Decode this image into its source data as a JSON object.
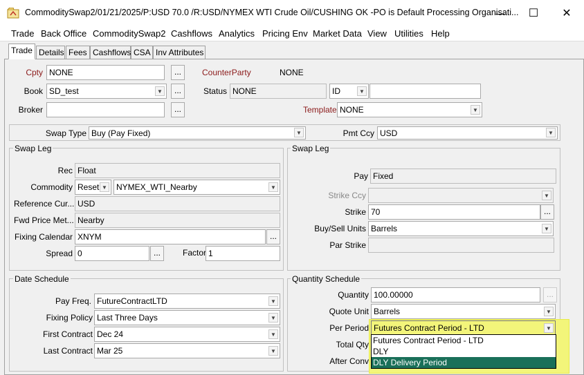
{
  "window": {
    "title": "CommoditySwap2/01/21/2025/P:USD 70.0 /R:USD/NYMEX WTI Crude Oil/CUSHING OK  -PO is Default Processing Organisati...",
    "minimize": "—",
    "maximize": "☐",
    "close": "✕"
  },
  "menu": [
    "Trade",
    "Back Office",
    "CommoditySwap2",
    "Cashflows",
    "Analytics",
    "Pricing Env",
    "Market Data",
    "View",
    "Utilities",
    "Help"
  ],
  "tabs": [
    "Trade",
    "Details",
    "Fees",
    "Cashflows",
    "CSA",
    "Inv Attributes"
  ],
  "header": {
    "cpty_label": "Cpty",
    "cpty_value": "NONE",
    "counterparty_label": "CounterParty",
    "counterparty_value": "NONE",
    "book_label": "Book",
    "book_value": "SD_test",
    "status_label": "Status",
    "status_value": "NONE",
    "status_id": "ID",
    "status_extra": "",
    "broker_label": "Broker",
    "broker_value": "",
    "template_label": "Template",
    "template_value": "NONE",
    "dots": "..."
  },
  "swap": {
    "swap_type_label": "Swap Type",
    "swap_type_value": "Buy (Pay Fixed)",
    "pmt_ccy_label": "Pmt Ccy",
    "pmt_ccy_value": "USD"
  },
  "left_leg": {
    "title": "Swap Leg",
    "rec_label": "Rec",
    "rec_value": "Float",
    "commodity_label": "Commodity",
    "commodity_reset": "Reset",
    "commodity_value": "NYMEX_WTI_Nearby",
    "ref_cur_label": "Reference Cur...",
    "ref_cur_value": "USD",
    "fwd_price_label": "Fwd Price Met...",
    "fwd_price_value": "Nearby",
    "fixing_cal_label": "Fixing Calendar",
    "fixing_cal_value": "XNYM",
    "spread_label": "Spread",
    "spread_value": "0",
    "factor_label": "Factor",
    "factor_value": "1"
  },
  "right_leg": {
    "title": "Swap Leg",
    "pay_label": "Pay",
    "pay_value": "Fixed",
    "strike_ccy_label": "Strike Ccy",
    "strike_ccy_value": "",
    "strike_label": "Strike",
    "strike_value": "70",
    "units_label": "Buy/Sell Units",
    "units_value": "Barrels",
    "par_strike_label": "Par Strike",
    "par_strike_value": ""
  },
  "date_schedule": {
    "title": "Date Schedule",
    "pay_freq_label": "Pay Freq.",
    "pay_freq_value": "FutureContractLTD",
    "fixing_policy_label": "Fixing Policy",
    "fixing_policy_value": "Last Three Days",
    "first_contract_label": "First Contract",
    "first_contract_value": "Dec 24",
    "last_contract_label": "Last Contract",
    "last_contract_value": "Mar 25"
  },
  "quantity_schedule": {
    "title": "Quantity Schedule",
    "quantity_label": "Quantity",
    "quantity_value": "100.00000",
    "quote_unit_label": "Quote Unit",
    "quote_unit_value": "Barrels",
    "per_period_label": "Per Period",
    "per_period_value": "Futures Contract Period - LTD",
    "total_qty_label": "Total Qty",
    "after_conv_label": "After Conv",
    "dropdown_options": [
      "Futures Contract Period - LTD",
      "DLY",
      "DLY Delivery Period"
    ],
    "highlighted_option": "DLY Delivery Period"
  },
  "colors": {
    "highlight": "#f3f57a",
    "selection": "#1a7059",
    "label_red": "#8b1a1a"
  }
}
